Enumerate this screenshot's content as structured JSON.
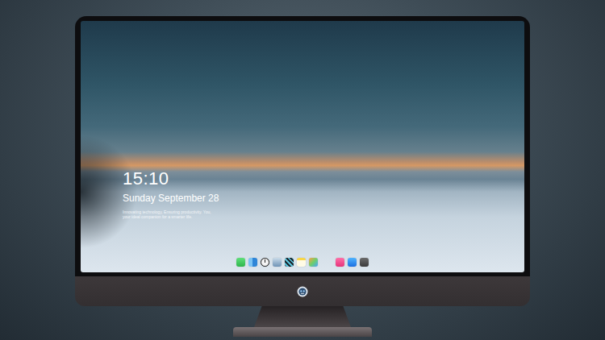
{
  "lock_screen": {
    "time": "15:10",
    "date": "Sunday September 28",
    "tagline": [
      "Innovating technology, Ensuring productivity. You,",
      "your ideal companion for a smarter life."
    ]
  }
}
